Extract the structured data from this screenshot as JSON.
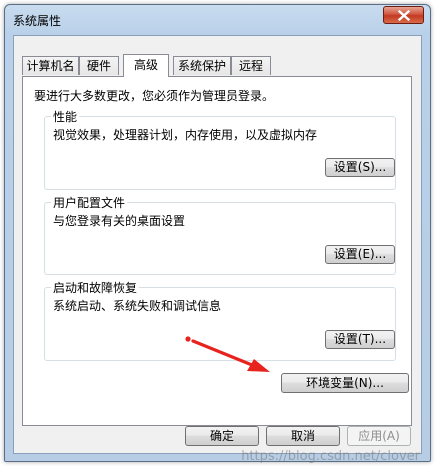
{
  "window": {
    "title": "系统属性"
  },
  "tabs": [
    {
      "label": "计算机名"
    },
    {
      "label": "硬件"
    },
    {
      "label": "高级"
    },
    {
      "label": "系统保护"
    },
    {
      "label": "远程"
    }
  ],
  "active_tab": "高级",
  "panel": {
    "intro": "要进行大多数更改，您必须作为管理员登录。",
    "performance": {
      "title": "性能",
      "description": "视觉效果，处理器计划，内存使用，以及虚拟内存",
      "button": "设置(S)..."
    },
    "user_profiles": {
      "title": "用户配置文件",
      "description": "与您登录有关的桌面设置",
      "button": "设置(E)..."
    },
    "startup_recovery": {
      "title": "启动和故障恢复",
      "description": "系统启动、系统失败和调试信息",
      "button": "设置(T)..."
    },
    "env_button": "环境变量(N)..."
  },
  "footer": {
    "ok": "确定",
    "cancel": "取消",
    "apply": "应用(A)"
  },
  "watermark": "https://blog.csdn.net/clover",
  "colors": {
    "arrow": "#e8231e",
    "close_button": "#c23a22",
    "title_bar": "#b8d0e9"
  }
}
